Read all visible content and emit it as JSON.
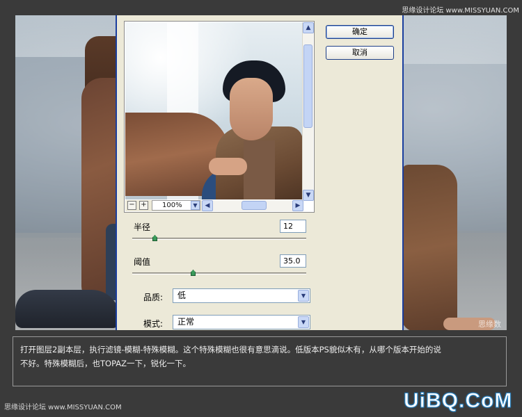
{
  "watermark_top": "思缘设计论坛 www.MISSYUAN.COM",
  "watermark_bottom": "思缘设计论坛 www.MISSYUAN.COM",
  "photo_watermark": "思缘数码",
  "logo_text": "UiBQ.CoM",
  "dialog": {
    "ok_label": "确定",
    "cancel_label": "取消",
    "zoom": {
      "minus": "−",
      "plus": "+",
      "value": "100%"
    },
    "radius": {
      "label": "半径",
      "value": "12",
      "slider_fraction": 0.13
    },
    "threshold": {
      "label": "阈值",
      "value": "35.0",
      "slider_fraction": 0.35
    },
    "quality": {
      "label": "品质:",
      "selected": "低"
    },
    "mode": {
      "label": "模式:",
      "selected": "正常"
    }
  },
  "caption": {
    "line1": "打开图层2副本层，执行滤镜-模糊-特殊模糊。这个特殊模糊也很有意思滴说。低版本PS貌似木有，从哪个版本开始的说",
    "line2": "不好。特殊模糊后，也TOPAZ一下，锐化一下。"
  },
  "colors": {
    "dialog_bg": "#ece9d8",
    "dialog_border": "#1a3e9e",
    "page_bg": "#3a3a3a",
    "logo_stroke": "#2a86c8"
  }
}
